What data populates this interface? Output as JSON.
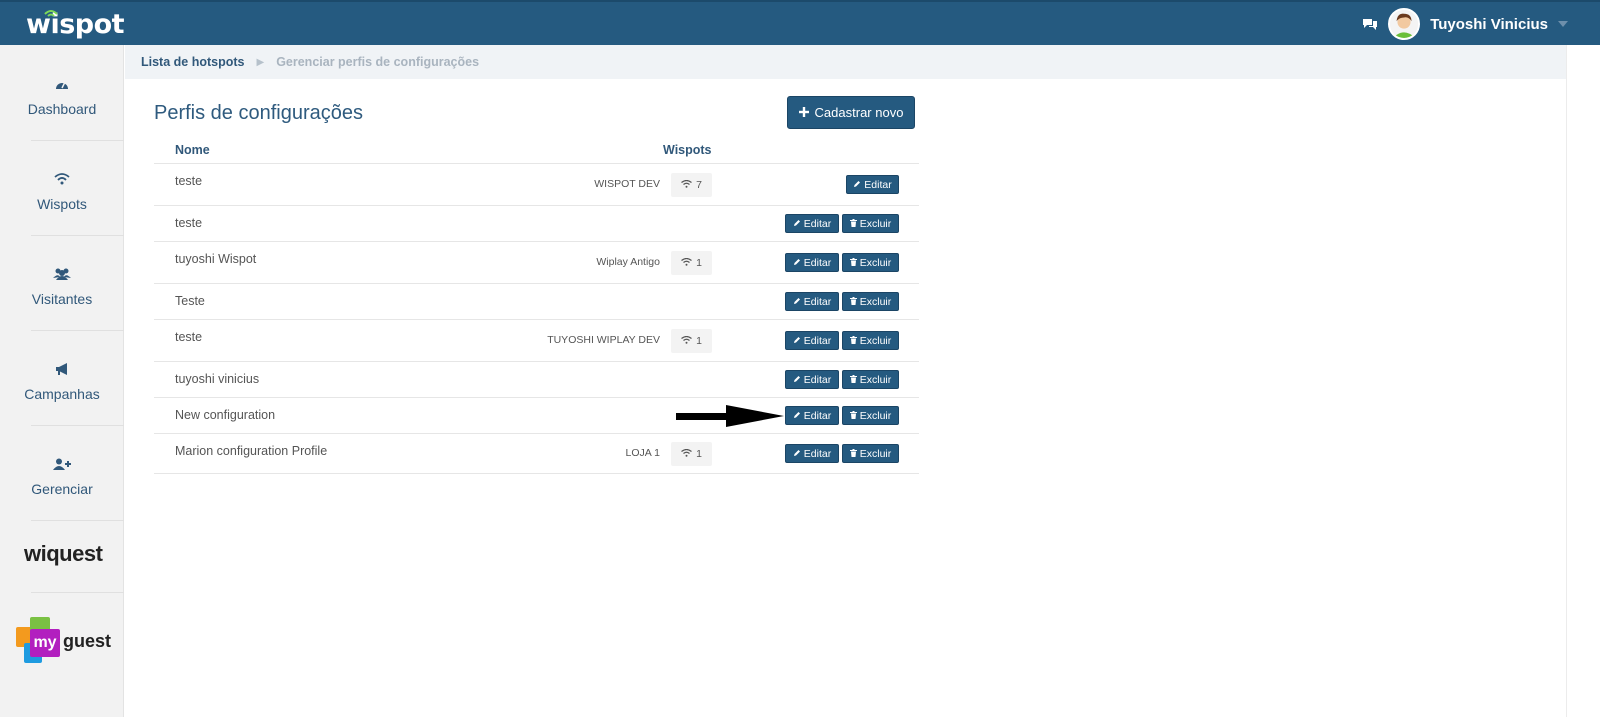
{
  "header": {
    "logo": "wispot",
    "user_name": "Tuyoshi Vinicius",
    "colors": {
      "bar": "#255a80",
      "accent": "#255a80"
    },
    "icons": [
      "chat-icon",
      "avatar",
      "caret-down-icon"
    ]
  },
  "sidebar": {
    "items": [
      {
        "label": "Dashboard",
        "icon": "dashboard-icon"
      },
      {
        "label": "Wispots",
        "icon": "wifi-icon"
      },
      {
        "label": "Visitantes",
        "icon": "users-icon"
      },
      {
        "label": "Campanhas",
        "icon": "megaphone-icon"
      },
      {
        "label": "Gerenciar",
        "icon": "user-plus-icon"
      }
    ],
    "brand_wiquest": "wiquest",
    "brand_myguest_my": "my",
    "brand_myguest_guest": "guest"
  },
  "breadcrumb": {
    "link": "Lista de hotspots",
    "current": "Gerenciar perfis de configurações"
  },
  "main": {
    "title": "Perfis de configurações",
    "new_button": "Cadastrar novo",
    "columns": {
      "name": "Nome",
      "wispots": "Wispots"
    },
    "edit_label": "Editar",
    "delete_label": "Excluir",
    "rows": [
      {
        "name": "teste",
        "wispot": "WISPOT DEV",
        "count": "7",
        "deletable": false
      },
      {
        "name": "teste",
        "wispot": "",
        "count": "",
        "deletable": true
      },
      {
        "name": "tuyoshi Wispot",
        "wispot": "Wiplay Antigo",
        "count": "1",
        "deletable": true
      },
      {
        "name": "Teste",
        "wispot": "",
        "count": "",
        "deletable": true
      },
      {
        "name": "teste",
        "wispot": "TUYOSHI WIPLAY DEV",
        "count": "1",
        "deletable": true
      },
      {
        "name": "tuyoshi vinicius",
        "wispot": "",
        "count": "",
        "deletable": true
      },
      {
        "name": "New configuration",
        "wispot": "",
        "count": "",
        "deletable": true
      },
      {
        "name": "Marion configuration Profile",
        "wispot": "LOJA 1",
        "count": "1",
        "deletable": true
      }
    ]
  }
}
